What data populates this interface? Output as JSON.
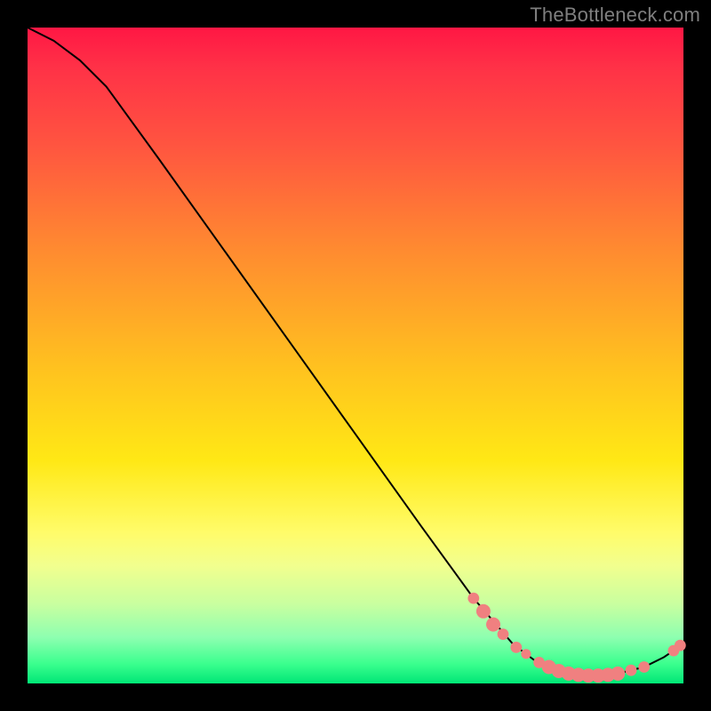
{
  "attribution": "TheBottleneck.com",
  "chart_data": {
    "type": "line",
    "title": "",
    "xlabel": "",
    "ylabel": "",
    "xlim": [
      0,
      100
    ],
    "ylim": [
      0,
      100
    ],
    "curve": [
      {
        "x": 0,
        "y": 100
      },
      {
        "x": 4,
        "y": 98
      },
      {
        "x": 8,
        "y": 95
      },
      {
        "x": 12,
        "y": 91
      },
      {
        "x": 20,
        "y": 80
      },
      {
        "x": 30,
        "y": 66
      },
      {
        "x": 40,
        "y": 52
      },
      {
        "x": 50,
        "y": 38
      },
      {
        "x": 60,
        "y": 24
      },
      {
        "x": 68,
        "y": 13
      },
      {
        "x": 74,
        "y": 6
      },
      {
        "x": 78,
        "y": 3
      },
      {
        "x": 82,
        "y": 1.5
      },
      {
        "x": 86,
        "y": 1.2
      },
      {
        "x": 90,
        "y": 1.5
      },
      {
        "x": 94,
        "y": 2.5
      },
      {
        "x": 97,
        "y": 4
      },
      {
        "x": 100,
        "y": 6
      }
    ],
    "marker_clusters": [
      {
        "x": 68,
        "y": 13,
        "r": 4
      },
      {
        "x": 69.5,
        "y": 11,
        "r": 5
      },
      {
        "x": 71,
        "y": 9,
        "r": 5
      },
      {
        "x": 72.5,
        "y": 7.5,
        "r": 4
      },
      {
        "x": 74.5,
        "y": 5.5,
        "r": 4
      },
      {
        "x": 76,
        "y": 4.5,
        "r": 3.5
      },
      {
        "x": 78,
        "y": 3.2,
        "r": 4
      },
      {
        "x": 79.5,
        "y": 2.5,
        "r": 5
      },
      {
        "x": 81,
        "y": 1.9,
        "r": 5
      },
      {
        "x": 82.5,
        "y": 1.5,
        "r": 5
      },
      {
        "x": 84,
        "y": 1.3,
        "r": 5
      },
      {
        "x": 85.5,
        "y": 1.2,
        "r": 5
      },
      {
        "x": 87,
        "y": 1.2,
        "r": 5
      },
      {
        "x": 88.5,
        "y": 1.3,
        "r": 5
      },
      {
        "x": 90,
        "y": 1.5,
        "r": 5
      },
      {
        "x": 92,
        "y": 2,
        "r": 4
      },
      {
        "x": 94,
        "y": 2.5,
        "r": 4
      },
      {
        "x": 98.5,
        "y": 5,
        "r": 4
      },
      {
        "x": 99.5,
        "y": 5.8,
        "r": 4
      }
    ],
    "marker_color": "#F08080",
    "line_color": "#000000",
    "line_width": 2
  }
}
